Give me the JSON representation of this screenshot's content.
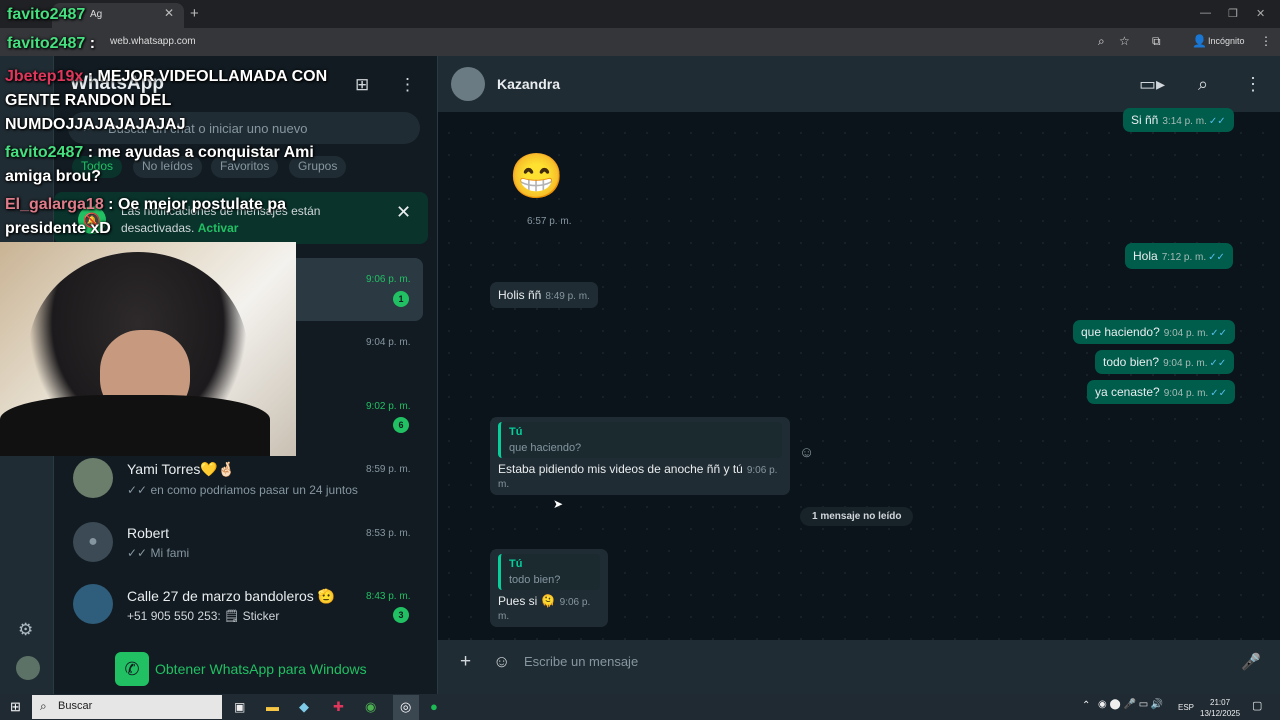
{
  "browser": {
    "tab_title": "Ag",
    "url": "web.whatsapp.com",
    "incognito": "Incógnito"
  },
  "app": {
    "title": "WhatsApp",
    "search_placeholder": "Buscar un chat o iniciar uno nuevo",
    "filters": [
      "Todos",
      "No leídos",
      "Favoritos",
      "Grupos"
    ],
    "notice": {
      "text": "Las notificaciones de mensajes están desactivadas.",
      "link": "Activar"
    },
    "get_app": "Obtener WhatsApp para Windows"
  },
  "chats": [
    {
      "time": "9:06 p. m.",
      "badge": "1"
    },
    {
      "time": "9:04 p. m."
    },
    {
      "time": "9:02 p. m.",
      "badge": "6"
    },
    {
      "name": "Yami Torres💛🤞🏻",
      "time": "8:59 p. m.",
      "preview": "✓✓ en como podriamos pasar un 24 juntos"
    },
    {
      "name": "Robert",
      "time": "8:53 p. m.",
      "preview": "✓✓ Mi fami"
    },
    {
      "name": "Calle 27 de marzo bandoleros 🫡",
      "time": "8:43 p. m.",
      "preview": "+51 905 550 253: 🗒 Sticker",
      "badge": "3"
    }
  ],
  "conversation": {
    "contact": "Kazandra",
    "m0": {
      "text": "Si ññ",
      "time": "3:14 p. m."
    },
    "emoji_msg": {
      "emoji": "😁",
      "time": "6:57 p. m."
    },
    "m1": {
      "text": "Hola",
      "time": "7:12 p. m."
    },
    "m2": {
      "text": "Holis ññ",
      "time": "8:49 p. m."
    },
    "m3": {
      "text": "que haciendo?",
      "time": "9:04 p. m."
    },
    "m4": {
      "text": "todo bien?",
      "time": "9:04 p. m."
    },
    "m5": {
      "text": "ya cenaste?",
      "time": "9:04 p. m."
    },
    "m6": {
      "quote_name": "Tú",
      "quote_text": "que haciendo?",
      "text": "Estaba pidiendo mis videos de anoche ññ y tú",
      "time": "9:06 p. m."
    },
    "unread_divider": "1 mensaje no leído",
    "m7": {
      "quote_name": "Tú",
      "quote_text": "todo bien?",
      "text": "Pues si 🫠",
      "time": "9:06 p. m."
    },
    "input_placeholder": "Escribe un mensaje"
  },
  "stream_chat": [
    {
      "user": "favito2487",
      "text": ""
    },
    {
      "user": "favito2487",
      "text": ""
    },
    {
      "user": "Jbetep19x",
      "text": "MEJOR VIDEOLLAMADA CON GENTE RANDON DEL NUMDOJJAJAJAJAJAJ"
    },
    {
      "user": "favito2487",
      "text": "me ayudas a conquistar Ami amiga brou?"
    },
    {
      "user": "El_galarga18",
      "text": "Oe mejor postulate pa presidente xD"
    }
  ],
  "taskbar": {
    "search": "Buscar",
    "lang": "ESP",
    "time": "21:07",
    "date": "13/12/2025"
  }
}
